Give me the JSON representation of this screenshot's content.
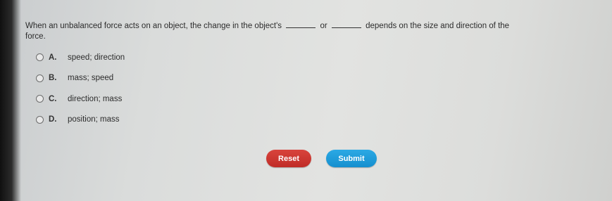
{
  "question": {
    "text_before": "When an unbalanced force acts on an object, the change in the object's",
    "connector": "or",
    "text_after": "depends on the size and direction of the",
    "text_wrap": "force."
  },
  "options": [
    {
      "letter": "A.",
      "text": "speed; direction"
    },
    {
      "letter": "B.",
      "text": "mass; speed"
    },
    {
      "letter": "C.",
      "text": "direction; mass"
    },
    {
      "letter": "D.",
      "text": "position; mass"
    }
  ],
  "buttons": {
    "reset_label": "Reset",
    "submit_label": "Submit"
  },
  "colors": {
    "reset": "#c8332d",
    "submit": "#1a9ad8"
  }
}
